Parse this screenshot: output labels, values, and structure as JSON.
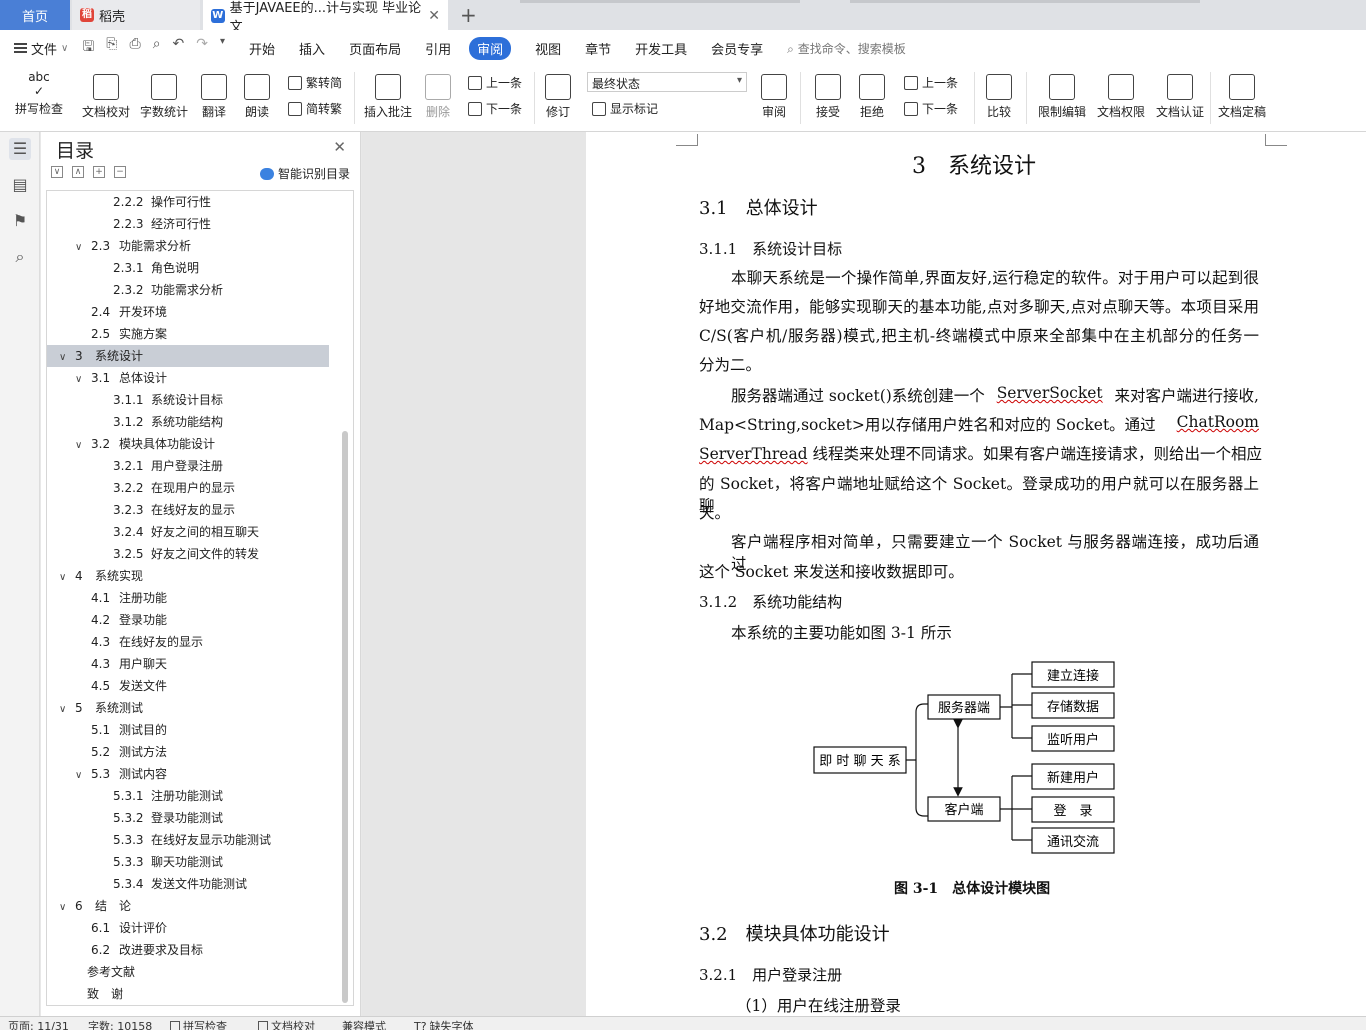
{
  "tabs": {
    "home": "首页",
    "daoke": "稻壳",
    "doc": "基于JAVAEE的...计与实现 毕业论文",
    "add": "+"
  },
  "menu": {
    "file": "文件",
    "items": [
      "开始",
      "插入",
      "页面布局",
      "引用",
      "审阅",
      "视图",
      "章节",
      "开发工具",
      "会员专享"
    ],
    "active": "审阅",
    "search_placeholder": "查找命令、搜索模板"
  },
  "ribbon": {
    "spellcheck": "拼写检查",
    "proofread": "文档校对",
    "wordcount": "字数统计",
    "translate": "翻译",
    "read": "朗读",
    "trad": "繁转简",
    "simp": "简转繁",
    "insert_comment": "插入批注",
    "delete": "删除",
    "prev": "上一条",
    "next": "下一条",
    "track": "修订",
    "final_state": "最终状态",
    "show_marks": "显示标记",
    "review": "审阅",
    "accept": "接受",
    "reject": "拒绝",
    "prev2": "上一条",
    "next2": "下一条",
    "compare": "比较",
    "restrict": "限制编辑",
    "perm": "文档权限",
    "cert": "文档认证",
    "finalize": "文档定稿"
  },
  "toc": {
    "title": "目录",
    "smart": "智能识别目录",
    "items": [
      {
        "num": "2.2.2",
        "text": "操作可行性",
        "level": 3
      },
      {
        "num": "2.2.3",
        "text": "经济可行性",
        "level": 3
      },
      {
        "num": "2.3",
        "text": "功能需求分析",
        "level": 2,
        "toggle": "∨"
      },
      {
        "num": "2.3.1",
        "text": "角色说明",
        "level": 3
      },
      {
        "num": "2.3.2",
        "text": "功能需求分析",
        "level": 3
      },
      {
        "num": "2.4",
        "text": "开发环境",
        "level": 2
      },
      {
        "num": "2.5",
        "text": "实施方案",
        "level": 2
      },
      {
        "num": "3",
        "text": "系统设计",
        "level": 1,
        "toggle": "∨",
        "selected": true
      },
      {
        "num": "3.1",
        "text": "总体设计",
        "level": 2,
        "toggle": "∨"
      },
      {
        "num": "3.1.1",
        "text": "系统设计目标",
        "level": 3
      },
      {
        "num": "3.1.2",
        "text": "系统功能结构",
        "level": 3
      },
      {
        "num": "3.2",
        "text": "模块具体功能设计",
        "level": 2,
        "toggle": "∨"
      },
      {
        "num": "3.2.1",
        "text": "用户登录注册",
        "level": 3
      },
      {
        "num": "3.2.2",
        "text": "在现用户的显示",
        "level": 3
      },
      {
        "num": "3.2.3",
        "text": "在线好友的显示",
        "level": 3
      },
      {
        "num": "3.2.4",
        "text": "好友之间的相互聊天",
        "level": 3
      },
      {
        "num": "3.2.5",
        "text": "好友之间文件的转发",
        "level": 3
      },
      {
        "num": "4",
        "text": "系统实现",
        "level": 1,
        "toggle": "∨"
      },
      {
        "num": "4.1",
        "text": "注册功能",
        "level": 2
      },
      {
        "num": "4.2",
        "text": "登录功能",
        "level": 2
      },
      {
        "num": "4.3",
        "text": "在线好友的显示",
        "level": 2
      },
      {
        "num": "4.3",
        "text": "用户聊天",
        "level": 2
      },
      {
        "num": "4.5",
        "text": "发送文件",
        "level": 2
      },
      {
        "num": "5",
        "text": "系统测试",
        "level": 1,
        "toggle": "∨"
      },
      {
        "num": "5.1",
        "text": "测试目的",
        "level": 2
      },
      {
        "num": "5.2",
        "text": "测试方法",
        "level": 2
      },
      {
        "num": "5.3",
        "text": "测试内容",
        "level": 2,
        "toggle": "∨"
      },
      {
        "num": "5.3.1",
        "text": "注册功能测试",
        "level": 3
      },
      {
        "num": "5.3.2",
        "text": "登录功能测试",
        "level": 3
      },
      {
        "num": "5.3.3",
        "text": "在线好友显示功能测试",
        "level": 3
      },
      {
        "num": "5.3.3",
        "text": "聊天功能测试",
        "level": 3
      },
      {
        "num": "5.3.4",
        "text": "发送文件功能测试",
        "level": 3
      },
      {
        "num": "6",
        "text": "结　论",
        "level": 1,
        "toggle": "∨"
      },
      {
        "num": "6.1",
        "text": "设计评价",
        "level": 2
      },
      {
        "num": "6.2",
        "text": "改进要求及目标",
        "level": 2
      },
      {
        "num": "",
        "text": "参考文献",
        "level": 0
      },
      {
        "num": "",
        "text": "致　谢",
        "level": 0
      }
    ]
  },
  "doc": {
    "chapter": "3　系统设计",
    "s31": "3.1　总体设计",
    "s311": "3.1.1　系统设计目标",
    "p1": [
      "本聊天系统是一个操作简单,界面友好,运行稳定的软件。对于用户可以起到很",
      "好地交流作用，能够实现聊天的基本功能,点对多聊天,点对点聊天等。本项目采用",
      "C/S(客户机/服务器)模式,把主机-终端模式中原来全部集中在主机部分的任务一",
      "分为二。"
    ],
    "p2a": "服务器端通过 socket()系统创建一个 ",
    "p2a_w": "ServerSocket",
    "p2a_t": " 来对客户端进行接收,",
    "p2b": "Map<String,socket>用以存储用户姓名和对应的 Socket。通过 ",
    "p2b_w": "ChatRoom",
    "p2c_w": "ServerThread",
    "p2c": " 线程类来处理不同请求。如果有客户端连接请求，则给出一个相应",
    "p2d": "的 Socket，将客户端地址赋给这个 Socket。登录成功的用户就可以在服务器上聊",
    "p2e": "天。",
    "p3": [
      "客户端程序相对简单，只需要建立一个 Socket 与服务器端连接，成功后通过",
      "这个 Socket 来发送和接收数据即可。"
    ],
    "s312": "3.1.2　系统功能结构",
    "p4": "本系统的主要功能如图 3-1 所示",
    "diagram": {
      "root": "即 时 聊 天 系",
      "server": "服务器端",
      "client": "客户端",
      "server_children": [
        "建立连接",
        "存储数据",
        "监听用户"
      ],
      "client_children": [
        "新建用户",
        "登　录",
        "通讯交流"
      ]
    },
    "caption": "图 3-1　总体设计模块图",
    "s32": "3.2　模块具体功能设计",
    "s321": "3.2.1　用户登录注册",
    "p5": "（1）用户在线注册登录"
  },
  "status": {
    "page": "页面: 11/31",
    "words": "字数: 10158",
    "spell": "拼写检查",
    "proof": "文档校对",
    "compat": "兼容模式",
    "missing_font": "缺失字体"
  }
}
